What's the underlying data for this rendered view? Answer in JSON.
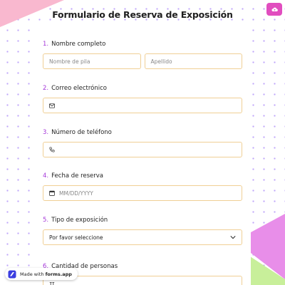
{
  "form": {
    "title": "Formulario de Reserva de Exposición",
    "fields": [
      {
        "number": "1.",
        "label": "Nombre completo",
        "first_placeholder": "Nombre de pila",
        "last_placeholder": "Apellido"
      },
      {
        "number": "2.",
        "label": "Correo electrónico"
      },
      {
        "number": "3.",
        "label": "Número de teléfono"
      },
      {
        "number": "4.",
        "label": "Fecha de reserva",
        "placeholder": "MM/DD/YYYY"
      },
      {
        "number": "5.",
        "label": "Tipo de exposición",
        "value": "Por favor seleccione"
      },
      {
        "number": "6.",
        "label": "Cantidad de personas"
      }
    ]
  },
  "footer": {
    "made_with": "Made with",
    "brand": "forms.app"
  },
  "colors": {
    "accent": "#a537d9",
    "input_border": "#f0cf95",
    "corner_button": "#e14dbf"
  },
  "icons": {
    "corner": "cloud-upload-icon",
    "email": "envelope-icon",
    "phone": "phone-icon",
    "date": "calendar-icon",
    "select": "chevron-down-icon",
    "number": "number-type-icon"
  }
}
